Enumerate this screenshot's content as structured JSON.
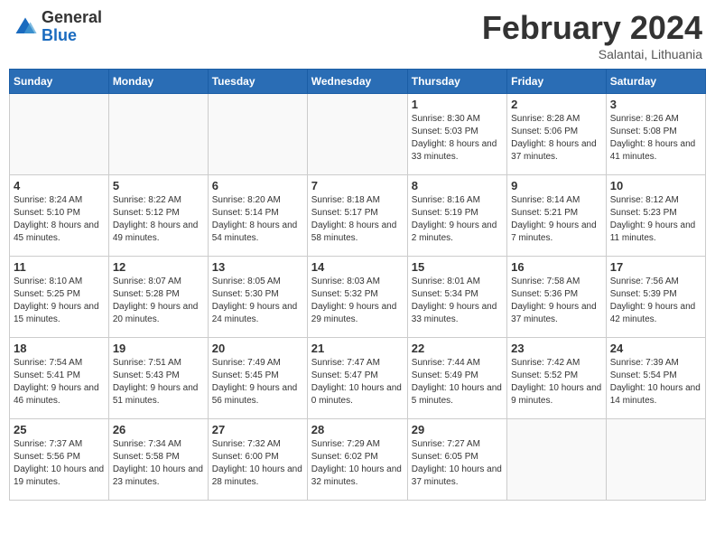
{
  "header": {
    "logo_general": "General",
    "logo_blue": "Blue",
    "month_title": "February 2024",
    "location": "Salantai, Lithuania"
  },
  "weekdays": [
    "Sunday",
    "Monday",
    "Tuesday",
    "Wednesday",
    "Thursday",
    "Friday",
    "Saturday"
  ],
  "weeks": [
    [
      {
        "day": "",
        "sunrise": "",
        "sunset": "",
        "daylight": ""
      },
      {
        "day": "",
        "sunrise": "",
        "sunset": "",
        "daylight": ""
      },
      {
        "day": "",
        "sunrise": "",
        "sunset": "",
        "daylight": ""
      },
      {
        "day": "",
        "sunrise": "",
        "sunset": "",
        "daylight": ""
      },
      {
        "day": "1",
        "sunrise": "Sunrise: 8:30 AM",
        "sunset": "Sunset: 5:03 PM",
        "daylight": "Daylight: 8 hours and 33 minutes."
      },
      {
        "day": "2",
        "sunrise": "Sunrise: 8:28 AM",
        "sunset": "Sunset: 5:06 PM",
        "daylight": "Daylight: 8 hours and 37 minutes."
      },
      {
        "day": "3",
        "sunrise": "Sunrise: 8:26 AM",
        "sunset": "Sunset: 5:08 PM",
        "daylight": "Daylight: 8 hours and 41 minutes."
      }
    ],
    [
      {
        "day": "4",
        "sunrise": "Sunrise: 8:24 AM",
        "sunset": "Sunset: 5:10 PM",
        "daylight": "Daylight: 8 hours and 45 minutes."
      },
      {
        "day": "5",
        "sunrise": "Sunrise: 8:22 AM",
        "sunset": "Sunset: 5:12 PM",
        "daylight": "Daylight: 8 hours and 49 minutes."
      },
      {
        "day": "6",
        "sunrise": "Sunrise: 8:20 AM",
        "sunset": "Sunset: 5:14 PM",
        "daylight": "Daylight: 8 hours and 54 minutes."
      },
      {
        "day": "7",
        "sunrise": "Sunrise: 8:18 AM",
        "sunset": "Sunset: 5:17 PM",
        "daylight": "Daylight: 8 hours and 58 minutes."
      },
      {
        "day": "8",
        "sunrise": "Sunrise: 8:16 AM",
        "sunset": "Sunset: 5:19 PM",
        "daylight": "Daylight: 9 hours and 2 minutes."
      },
      {
        "day": "9",
        "sunrise": "Sunrise: 8:14 AM",
        "sunset": "Sunset: 5:21 PM",
        "daylight": "Daylight: 9 hours and 7 minutes."
      },
      {
        "day": "10",
        "sunrise": "Sunrise: 8:12 AM",
        "sunset": "Sunset: 5:23 PM",
        "daylight": "Daylight: 9 hours and 11 minutes."
      }
    ],
    [
      {
        "day": "11",
        "sunrise": "Sunrise: 8:10 AM",
        "sunset": "Sunset: 5:25 PM",
        "daylight": "Daylight: 9 hours and 15 minutes."
      },
      {
        "day": "12",
        "sunrise": "Sunrise: 8:07 AM",
        "sunset": "Sunset: 5:28 PM",
        "daylight": "Daylight: 9 hours and 20 minutes."
      },
      {
        "day": "13",
        "sunrise": "Sunrise: 8:05 AM",
        "sunset": "Sunset: 5:30 PM",
        "daylight": "Daylight: 9 hours and 24 minutes."
      },
      {
        "day": "14",
        "sunrise": "Sunrise: 8:03 AM",
        "sunset": "Sunset: 5:32 PM",
        "daylight": "Daylight: 9 hours and 29 minutes."
      },
      {
        "day": "15",
        "sunrise": "Sunrise: 8:01 AM",
        "sunset": "Sunset: 5:34 PM",
        "daylight": "Daylight: 9 hours and 33 minutes."
      },
      {
        "day": "16",
        "sunrise": "Sunrise: 7:58 AM",
        "sunset": "Sunset: 5:36 PM",
        "daylight": "Daylight: 9 hours and 37 minutes."
      },
      {
        "day": "17",
        "sunrise": "Sunrise: 7:56 AM",
        "sunset": "Sunset: 5:39 PM",
        "daylight": "Daylight: 9 hours and 42 minutes."
      }
    ],
    [
      {
        "day": "18",
        "sunrise": "Sunrise: 7:54 AM",
        "sunset": "Sunset: 5:41 PM",
        "daylight": "Daylight: 9 hours and 46 minutes."
      },
      {
        "day": "19",
        "sunrise": "Sunrise: 7:51 AM",
        "sunset": "Sunset: 5:43 PM",
        "daylight": "Daylight: 9 hours and 51 minutes."
      },
      {
        "day": "20",
        "sunrise": "Sunrise: 7:49 AM",
        "sunset": "Sunset: 5:45 PM",
        "daylight": "Daylight: 9 hours and 56 minutes."
      },
      {
        "day": "21",
        "sunrise": "Sunrise: 7:47 AM",
        "sunset": "Sunset: 5:47 PM",
        "daylight": "Daylight: 10 hours and 0 minutes."
      },
      {
        "day": "22",
        "sunrise": "Sunrise: 7:44 AM",
        "sunset": "Sunset: 5:49 PM",
        "daylight": "Daylight: 10 hours and 5 minutes."
      },
      {
        "day": "23",
        "sunrise": "Sunrise: 7:42 AM",
        "sunset": "Sunset: 5:52 PM",
        "daylight": "Daylight: 10 hours and 9 minutes."
      },
      {
        "day": "24",
        "sunrise": "Sunrise: 7:39 AM",
        "sunset": "Sunset: 5:54 PM",
        "daylight": "Daylight: 10 hours and 14 minutes."
      }
    ],
    [
      {
        "day": "25",
        "sunrise": "Sunrise: 7:37 AM",
        "sunset": "Sunset: 5:56 PM",
        "daylight": "Daylight: 10 hours and 19 minutes."
      },
      {
        "day": "26",
        "sunrise": "Sunrise: 7:34 AM",
        "sunset": "Sunset: 5:58 PM",
        "daylight": "Daylight: 10 hours and 23 minutes."
      },
      {
        "day": "27",
        "sunrise": "Sunrise: 7:32 AM",
        "sunset": "Sunset: 6:00 PM",
        "daylight": "Daylight: 10 hours and 28 minutes."
      },
      {
        "day": "28",
        "sunrise": "Sunrise: 7:29 AM",
        "sunset": "Sunset: 6:02 PM",
        "daylight": "Daylight: 10 hours and 32 minutes."
      },
      {
        "day": "29",
        "sunrise": "Sunrise: 7:27 AM",
        "sunset": "Sunset: 6:05 PM",
        "daylight": "Daylight: 10 hours and 37 minutes."
      },
      {
        "day": "",
        "sunrise": "",
        "sunset": "",
        "daylight": ""
      },
      {
        "day": "",
        "sunrise": "",
        "sunset": "",
        "daylight": ""
      }
    ]
  ]
}
